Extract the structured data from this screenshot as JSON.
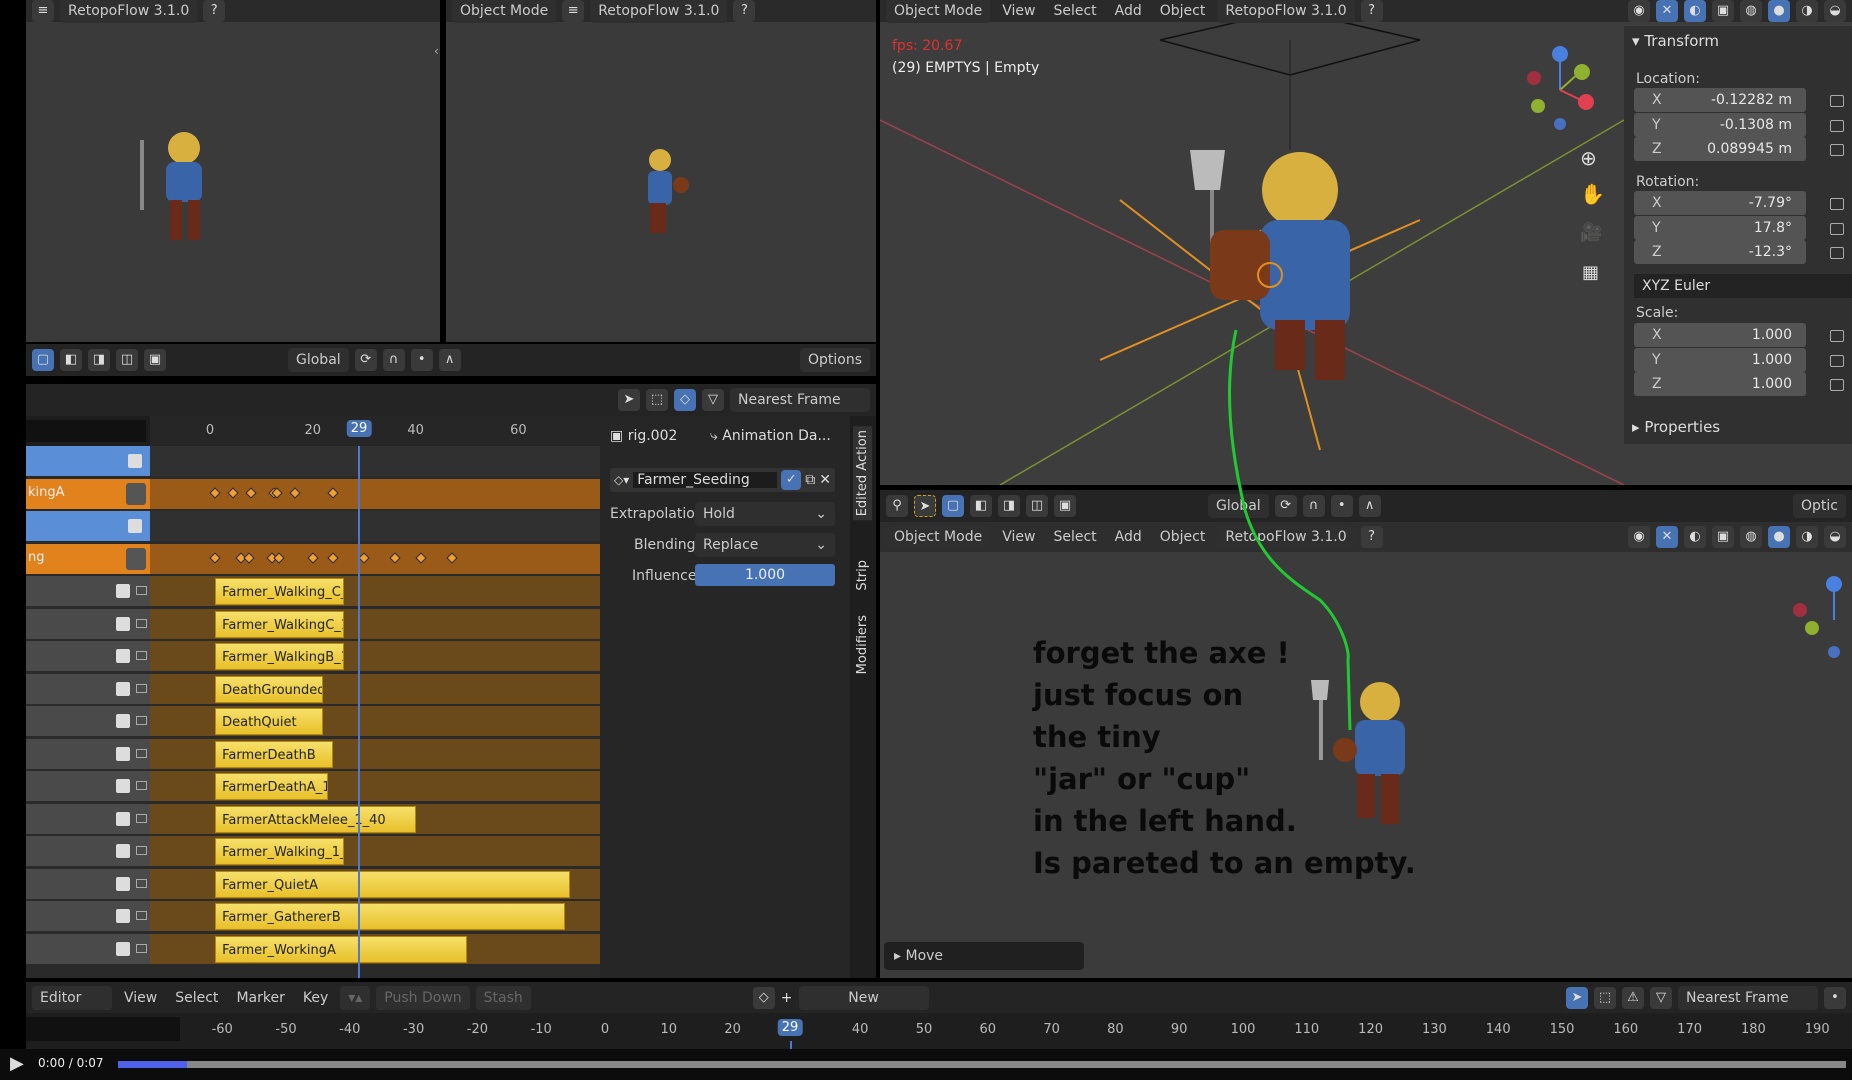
{
  "viewport_left": {
    "addon": "RetopoFlow 3.1.0"
  },
  "viewport_mid": {
    "mode": "Object Mode",
    "addon": "RetopoFlow 3.1.0"
  },
  "left_toolbar": {
    "orientation": "Global",
    "options": "Options"
  },
  "nla": {
    "snap": "Nearest Frame",
    "ruler_ticks": [
      0,
      20,
      40,
      60
    ],
    "current_frame": "29",
    "tracks": [
      {
        "type": "blue"
      },
      {
        "type": "orange",
        "label": "kingA",
        "keys": [
          1,
          4.5,
          8,
          12.5,
          13,
          16.5,
          24
        ]
      },
      {
        "type": "blue"
      },
      {
        "type": "orange",
        "label": "ng",
        "keys": [
          1,
          6,
          7.5,
          12,
          13.5,
          20,
          24,
          30,
          36,
          41,
          47
        ]
      },
      {
        "type": "strip",
        "name": "Farmer_Walking_C_",
        "start": 1,
        "end": 26
      },
      {
        "type": "strip",
        "name": "Farmer_WalkingC_1",
        "start": 1,
        "end": 26
      },
      {
        "type": "strip",
        "name": "Farmer_WalkingB_1",
        "start": 1,
        "end": 26
      },
      {
        "type": "strip",
        "name": "DeathGrounded",
        "start": 1,
        "end": 22
      },
      {
        "type": "strip",
        "name": "DeathQuiet",
        "start": 1,
        "end": 22
      },
      {
        "type": "strip",
        "name": "FarmerDeathB",
        "start": 1,
        "end": 24
      },
      {
        "type": "strip",
        "name": "FarmerDeathA_1_2",
        "start": 1,
        "end": 23
      },
      {
        "type": "strip",
        "name": "FarmerAttackMelee_1_40",
        "start": 1,
        "end": 40
      },
      {
        "type": "strip",
        "name": "Farmer_Walking_1_",
        "start": 1,
        "end": 26
      },
      {
        "type": "strip",
        "name": "Farmer_QuietA",
        "start": 1,
        "end": 70
      },
      {
        "type": "strip",
        "name": "Farmer_GathererB",
        "start": 1,
        "end": 69
      },
      {
        "type": "strip",
        "name": "Farmer_WorkingA",
        "start": 1,
        "end": 50
      }
    ],
    "sidebar": {
      "object": "rig.002",
      "anim": "Animation Da...",
      "action": "Farmer_Seeding",
      "extrapolation_label": "Extrapolation",
      "extrapolation": "Hold",
      "blending_label": "Blending",
      "blending": "Replace",
      "influence_label": "Influence",
      "influence": "1.000",
      "tabs": [
        "Edited Action",
        "Strip",
        "Modifiers"
      ]
    }
  },
  "viewport3d": {
    "mode": "Object Mode",
    "menus": [
      "View",
      "Select",
      "Add",
      "Object"
    ],
    "addon": "RetopoFlow 3.1.0",
    "fps": "fps: 20.67",
    "info": "(29) EMPTYS | Empty"
  },
  "transform": {
    "title": "Transform",
    "location_label": "Location:",
    "location": [
      [
        "X",
        "-0.12282 m"
      ],
      [
        "Y",
        "-0.1308 m"
      ],
      [
        "Z",
        "0.089945 m"
      ]
    ],
    "rotation_label": "Rotation:",
    "rotation": [
      [
        "X",
        "-7.79°"
      ],
      [
        "Y",
        "17.8°"
      ],
      [
        "Z",
        "-12.3°"
      ]
    ],
    "rotation_mode": "XYZ Euler",
    "scale_label": "Scale:",
    "scale": [
      [
        "X",
        "1.000"
      ],
      [
        "Y",
        "1.000"
      ],
      [
        "Z",
        "1.000"
      ]
    ],
    "properties": "Properties"
  },
  "viewport_lower": {
    "orientation": "Global",
    "options": "Optic",
    "mode": "Object Mode",
    "menus": [
      "View",
      "Select",
      "Add",
      "Object"
    ],
    "addon": "RetopoFlow 3.1.0",
    "operator_panel": "Move"
  },
  "annotation": [
    "forget the axe !",
    "just focus on",
    "the tiny",
    "\"jar\" or \"cup\"",
    "in the left hand.",
    "Is pareted to an empty."
  ],
  "timeline": {
    "editor": "Editor",
    "menus": [
      "View",
      "Select",
      "Marker",
      "Key"
    ],
    "push_down": "Push Down",
    "stash": "Stash",
    "new": "New",
    "snap": "Nearest Frame",
    "ticks": [
      -60,
      -50,
      -40,
      -30,
      -20,
      -10,
      0,
      10,
      20,
      40,
      50,
      60,
      70,
      80,
      90,
      100,
      110,
      120,
      130,
      140,
      150,
      160,
      170,
      180,
      190
    ],
    "current_frame": "29"
  },
  "video": {
    "time": "0:00 / 0:07",
    "progress": 0.04
  },
  "colors": {
    "accent": "#4772b3",
    "strip": "#f0cf40",
    "track_orange": "#e2821d",
    "annotation_line": "#22c832"
  }
}
